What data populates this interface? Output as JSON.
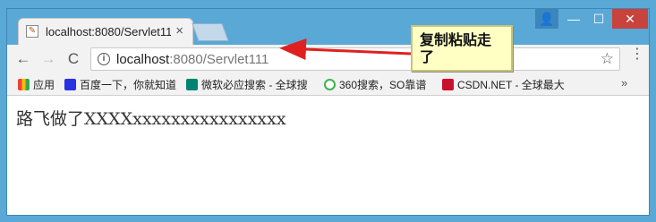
{
  "browser": {
    "tab": {
      "title": "localhost:8080/Servlet111",
      "close": "×"
    },
    "window_controls": {
      "user": "👤",
      "minimize": "—",
      "maximize": "☐",
      "close": "✕"
    },
    "toolbar": {
      "back": "←",
      "forward": "→",
      "reload": "C",
      "url_host": "localhost",
      "url_rest": ":8080/Servlet111",
      "star": "☆",
      "menu": "⋮"
    },
    "bookmarks": [
      {
        "label": "应用",
        "icon": "apps-icon",
        "color": "#4285f4"
      },
      {
        "label": "百度一下，你就知道",
        "icon": "baidu-paw-icon",
        "color": "#2932e1"
      },
      {
        "label": "微软必应搜索 - 全球搜",
        "icon": "bing-icon",
        "color": "#008373"
      },
      {
        "label": "360搜索，SO靠谱",
        "icon": "so360-icon",
        "color": "#3bb64a"
      },
      {
        "label": "CSDN.NET - 全球最大",
        "icon": "csdn-icon",
        "color": "#c8102e"
      }
    ],
    "bookmarks_more": "»"
  },
  "page": {
    "body_text": "路飞做了XXXXxxxxxxxxxxxxxxxx"
  },
  "annotation": {
    "callout_text": "复制粘贴走了",
    "arrow_color": "#e02020"
  }
}
